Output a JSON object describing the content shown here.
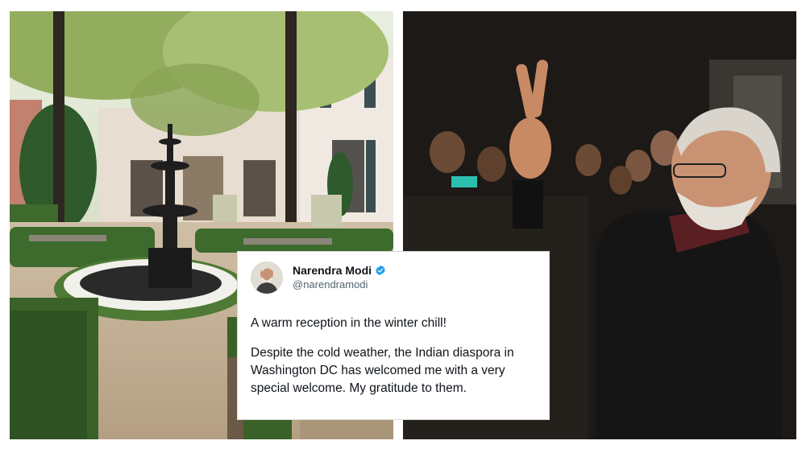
{
  "images": {
    "left": "garden-courtyard-fountain",
    "right": "leader-waving-to-crowd"
  },
  "tweet": {
    "name": "Narendra Modi",
    "handle": "@narendramodi",
    "verified_icon": "verified-badge-icon",
    "verified_color": "#1d9bf0",
    "line1": "A warm reception in the winter chill!",
    "line2": "Despite the cold weather, the Indian diaspora in Washington DC has welcomed me with a very special welcome. My gratitude to them."
  }
}
